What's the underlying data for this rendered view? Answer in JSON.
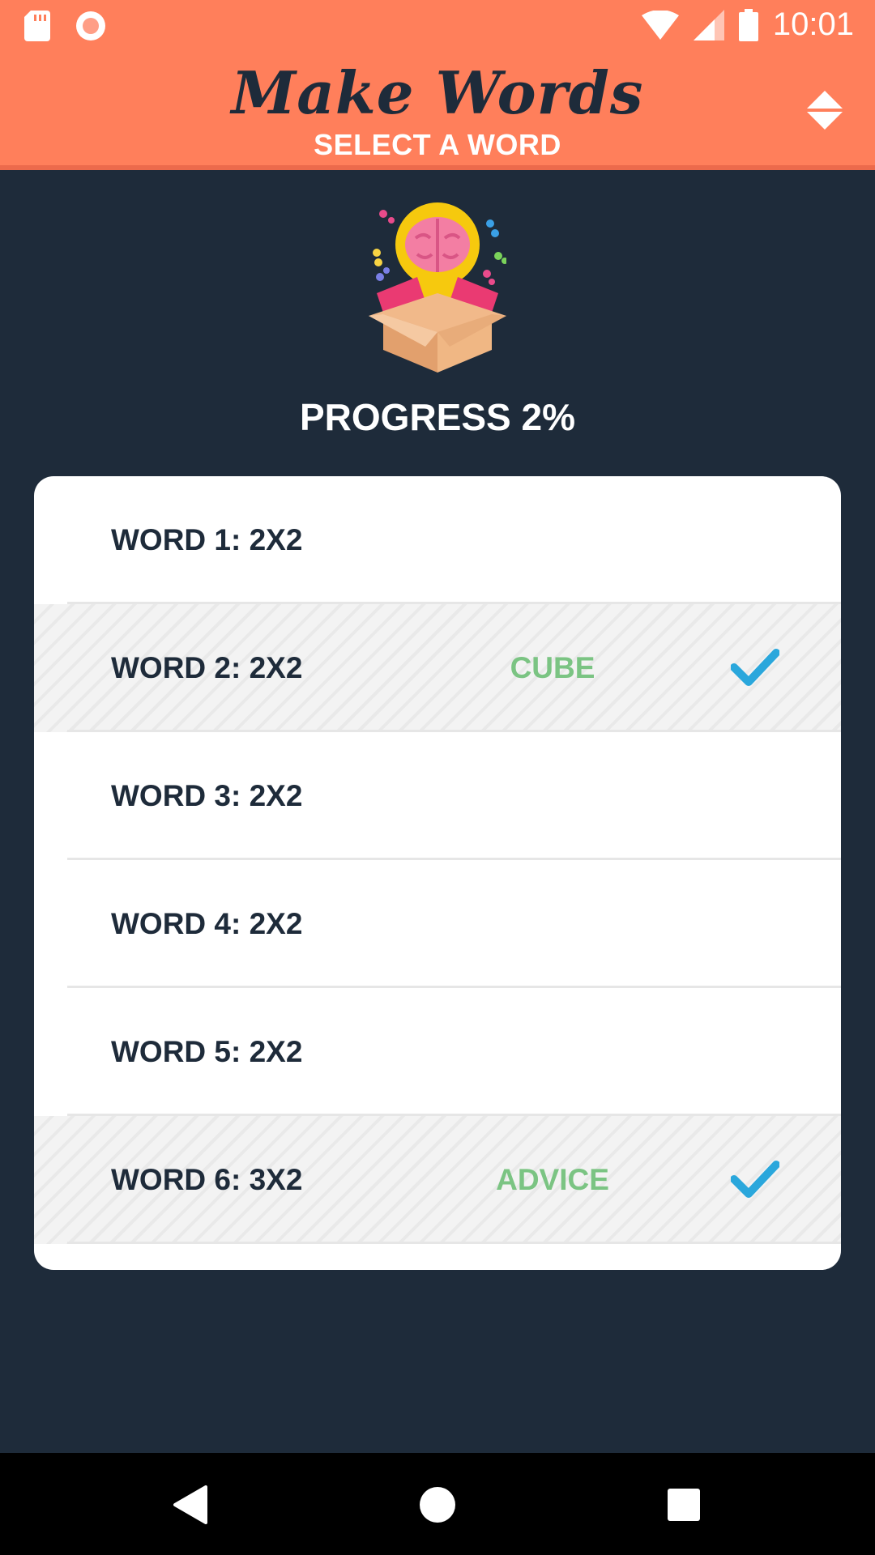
{
  "status_bar": {
    "time": "10:01",
    "icons": [
      "sd-card-icon",
      "record-icon",
      "wifi-icon",
      "signal-icon",
      "battery-icon"
    ]
  },
  "header": {
    "title": "Make Words",
    "subtitle": "SELECT A WORD",
    "sort_icon": "sort-updown-icon"
  },
  "hero_icon": "brain-lightbulb-box-icon",
  "progress_text": "PROGRESS 2%",
  "words": [
    {
      "label": "WORD 1: 2X2",
      "answer": "",
      "solved": false
    },
    {
      "label": "WORD 2: 2X2",
      "answer": "CUBE",
      "solved": true
    },
    {
      "label": "WORD 3: 2X2",
      "answer": "",
      "solved": false
    },
    {
      "label": "WORD 4: 2X2",
      "answer": "",
      "solved": false
    },
    {
      "label": "WORD 5: 2X2",
      "answer": "",
      "solved": false
    },
    {
      "label": "WORD 6: 3X2",
      "answer": "ADVICE",
      "solved": true
    }
  ],
  "colors": {
    "header_bg": "#ff7f5b",
    "page_bg": "#1e2b3a",
    "answer": "#7bc483",
    "check": "#2aa7dc"
  },
  "nav": [
    "back-icon",
    "home-icon",
    "recents-icon"
  ]
}
